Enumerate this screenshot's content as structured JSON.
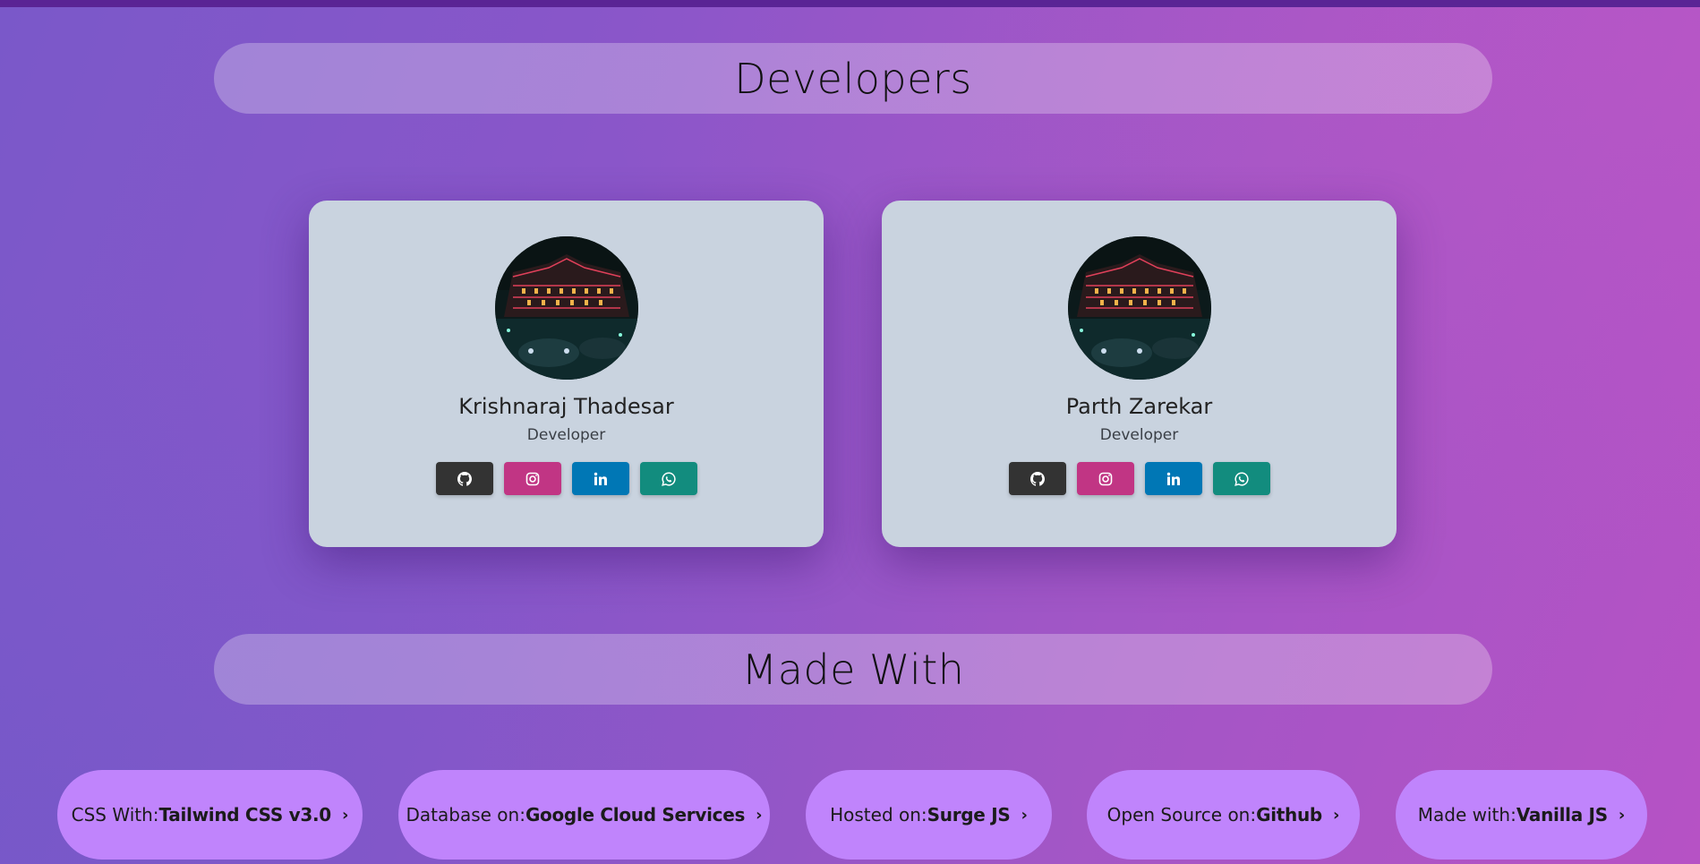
{
  "sections": {
    "developers_title": "Developers",
    "made_with_title": "Made With"
  },
  "developers": [
    {
      "name": "Krishnaraj Thadesar",
      "role": "Developer",
      "socials": [
        {
          "icon": "github-icon",
          "color": "#333333"
        },
        {
          "icon": "instagram-icon",
          "color": "#c13584"
        },
        {
          "icon": "linkedin-icon",
          "color": "#0077b5"
        },
        {
          "icon": "whatsapp-icon",
          "color": "#128c7e"
        }
      ]
    },
    {
      "name": "Parth Zarekar",
      "role": "Developer",
      "socials": [
        {
          "icon": "github-icon",
          "color": "#333333"
        },
        {
          "icon": "instagram-icon",
          "color": "#c13584"
        },
        {
          "icon": "linkedin-icon",
          "color": "#0077b5"
        },
        {
          "icon": "whatsapp-icon",
          "color": "#128c7e"
        }
      ]
    }
  ],
  "made_with": [
    {
      "label": "CSS With:",
      "value": "Tailwind CSS v3.0",
      "chevron": "›"
    },
    {
      "label": "Database on:",
      "value": "Google Cloud Services",
      "chevron": "›"
    },
    {
      "label": "Hosted on:",
      "value": "Surge JS",
      "chevron": "›"
    },
    {
      "label": "Open Source on:",
      "value": "Github",
      "chevron": "›"
    },
    {
      "label": "Made with:",
      "value": "Vanilla JS",
      "chevron": "›"
    }
  ],
  "colors": {
    "top_bar": "#5a2495",
    "card_bg": "#c9d3df",
    "pill_bg": "#c084fc"
  }
}
